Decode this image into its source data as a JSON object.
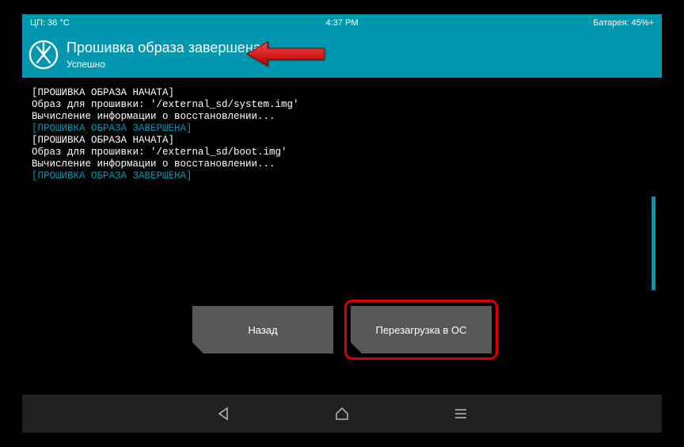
{
  "statusBar": {
    "cpu": "ЦП: 36 °C",
    "time": "4:37 PM",
    "battery": "Батарея: 45%+"
  },
  "header": {
    "title": "Прошивка образа завершена",
    "subtitle": "Успешно"
  },
  "log": {
    "lines": [
      {
        "text": "[ПРОШИВКА ОБРАЗА НАЧАТА]",
        "color": "white"
      },
      {
        "text": "Образ для прошивки: '/external_sd/system.img'",
        "color": "white"
      },
      {
        "text": "Вычисление информации о восстановлении...",
        "color": "white"
      },
      {
        "text": "[ПРОШИВКА ОБРАЗА ЗАВЕРШЕНА]",
        "color": "blue"
      },
      {
        "text": "[ПРОШИВКА ОБРАЗА НАЧАТА]",
        "color": "white"
      },
      {
        "text": "Образ для прошивки: '/external_sd/boot.img'",
        "color": "white"
      },
      {
        "text": "Вычисление информации о восстановлении...",
        "color": "white"
      },
      {
        "text": "[ПРОШИВКА ОБРАЗА ЗАВЕРШЕНА]",
        "color": "blue"
      }
    ]
  },
  "buttons": {
    "back": "Назад",
    "reboot": "Перезагрузка в ОС"
  },
  "colors": {
    "accent": "#0096b0",
    "highlight": "#d40000"
  }
}
